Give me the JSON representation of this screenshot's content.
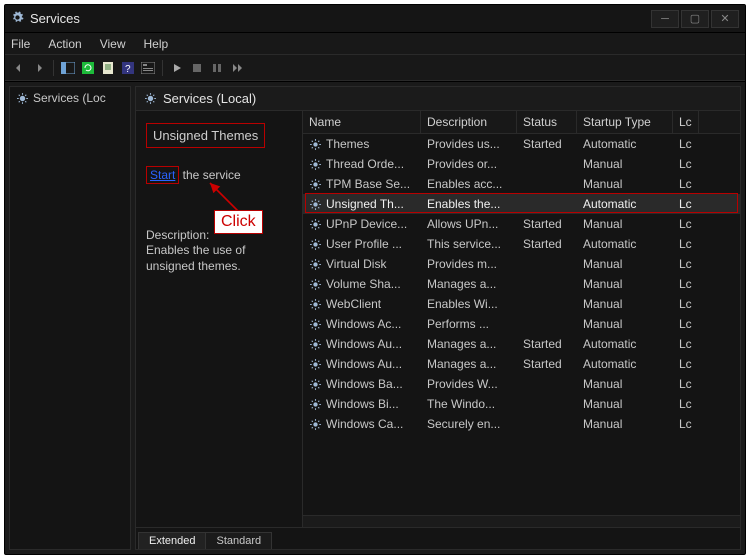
{
  "window": {
    "title": "Services"
  },
  "menubar": [
    "File",
    "Action",
    "View",
    "Help"
  ],
  "tree": {
    "root": "Services (Loc"
  },
  "header": {
    "title": "Services (Local)"
  },
  "detail": {
    "selected_name": "Unsigned Themes",
    "start_action": "Start",
    "start_rest": " the service",
    "desc_label": "Description:",
    "desc_text": "Enables the use of unsigned themes."
  },
  "annotation": {
    "click": "Click"
  },
  "columns": {
    "name": "Name",
    "desc": "Description",
    "status": "Status",
    "startup": "Startup Type",
    "logon": "Lc"
  },
  "rows": [
    {
      "name": "Themes",
      "desc": "Provides us...",
      "status": "Started",
      "startup": "Automatic",
      "logon": "Lc",
      "selected": false
    },
    {
      "name": "Thread Orde...",
      "desc": "Provides or...",
      "status": "",
      "startup": "Manual",
      "logon": "Lc",
      "selected": false
    },
    {
      "name": "TPM Base Se...",
      "desc": "Enables acc...",
      "status": "",
      "startup": "Manual",
      "logon": "Lc",
      "selected": false
    },
    {
      "name": "Unsigned Th...",
      "desc": "Enables the...",
      "status": "",
      "startup": "Automatic",
      "logon": "Lc",
      "selected": true
    },
    {
      "name": "UPnP Device...",
      "desc": "Allows UPn...",
      "status": "Started",
      "startup": "Manual",
      "logon": "Lc",
      "selected": false
    },
    {
      "name": "User Profile ...",
      "desc": "This service...",
      "status": "Started",
      "startup": "Automatic",
      "logon": "Lc",
      "selected": false
    },
    {
      "name": "Virtual Disk",
      "desc": "Provides m...",
      "status": "",
      "startup": "Manual",
      "logon": "Lc",
      "selected": false
    },
    {
      "name": "Volume Sha...",
      "desc": "Manages a...",
      "status": "",
      "startup": "Manual",
      "logon": "Lc",
      "selected": false
    },
    {
      "name": "WebClient",
      "desc": "Enables Wi...",
      "status": "",
      "startup": "Manual",
      "logon": "Lc",
      "selected": false
    },
    {
      "name": "Windows Ac...",
      "desc": "Performs ...",
      "status": "",
      "startup": "Manual",
      "logon": "Lc",
      "selected": false
    },
    {
      "name": "Windows Au...",
      "desc": "Manages a...",
      "status": "Started",
      "startup": "Automatic",
      "logon": "Lc",
      "selected": false
    },
    {
      "name": "Windows Au...",
      "desc": "Manages a...",
      "status": "Started",
      "startup": "Automatic",
      "logon": "Lc",
      "selected": false
    },
    {
      "name": "Windows Ba...",
      "desc": "Provides W...",
      "status": "",
      "startup": "Manual",
      "logon": "Lc",
      "selected": false
    },
    {
      "name": "Windows Bi...",
      "desc": "The Windo...",
      "status": "",
      "startup": "Manual",
      "logon": "Lc",
      "selected": false
    },
    {
      "name": "Windows Ca...",
      "desc": "Securely en...",
      "status": "",
      "startup": "Manual",
      "logon": "Lc",
      "selected": false
    }
  ],
  "tabs": {
    "extended": "Extended",
    "standard": "Standard"
  }
}
